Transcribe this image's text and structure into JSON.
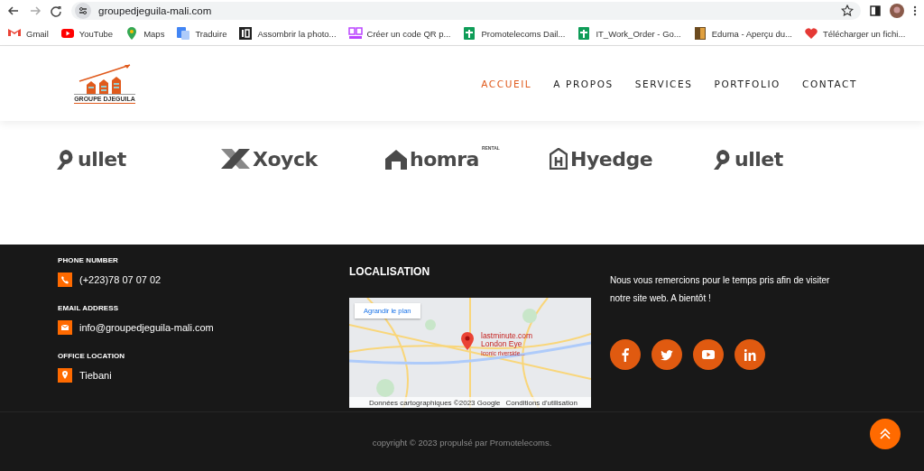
{
  "browser": {
    "url": "groupedjeguila-mali.com",
    "bookmarks": [
      {
        "label": "Gmail",
        "kind": "gmail"
      },
      {
        "label": "YouTube",
        "kind": "youtube"
      },
      {
        "label": "Maps",
        "kind": "maps"
      },
      {
        "label": "Traduire",
        "kind": "translate"
      },
      {
        "label": "Assombrir la photo...",
        "kind": "dark"
      },
      {
        "label": "Créer un code QR p...",
        "kind": "qr"
      },
      {
        "label": "Promotelecoms Dail...",
        "kind": "sheet"
      },
      {
        "label": "IT_Work_Order - Go...",
        "kind": "sheet"
      },
      {
        "label": "Eduma - Aperçu du...",
        "kind": "book"
      },
      {
        "label": "Télécharger un fichi...",
        "kind": "heart"
      }
    ]
  },
  "header": {
    "logo_text": "GROUPE DJEGUILA",
    "nav": [
      {
        "label": "ACCUEIL",
        "selected": true
      },
      {
        "label": "A PROPOS",
        "selected": false
      },
      {
        "label": "SERVICES",
        "selected": false
      },
      {
        "label": "PORTFOLIO",
        "selected": false
      },
      {
        "label": "CONTACT",
        "selected": false
      }
    ]
  },
  "partners": [
    {
      "name": "ullet",
      "kind": "nine"
    },
    {
      "name": "Xoyck",
      "kind": "x"
    },
    {
      "name": "homra",
      "tag": "RENTAL",
      "kind": "house"
    },
    {
      "name": "Hyedge",
      "kind": "hbox"
    },
    {
      "name": "ullet",
      "kind": "nine"
    }
  ],
  "footer": {
    "contacts": [
      {
        "label": "PHONE NUMBER",
        "value": "(+223)78 07 07 02",
        "kind": "phone"
      },
      {
        "label": "EMAIL ADDRESS",
        "value": "info@groupedjeguila-mali.com",
        "kind": "mail"
      },
      {
        "label": "OFFICE LOCATION",
        "value": "Tiebani",
        "kind": "pin"
      }
    ],
    "localisation": {
      "title": "LOCALISATION",
      "enlarge": "Agrandir le plan",
      "place": "lastminute.com London Eye",
      "place_note": "Iconic riverside...",
      "attribution": "Données cartographiques ©2023 Google",
      "terms": "Conditions d'utilisation"
    },
    "message": "Nous vous remercions pour le temps pris afin de visiter notre site web. A bientôt !",
    "socials": [
      {
        "kind": "facebook"
      },
      {
        "kind": "twitter"
      },
      {
        "kind": "youtube"
      },
      {
        "kind": "linkedin"
      }
    ],
    "copyright": "copyright © 2023 propulsé par Promotelecoms."
  }
}
